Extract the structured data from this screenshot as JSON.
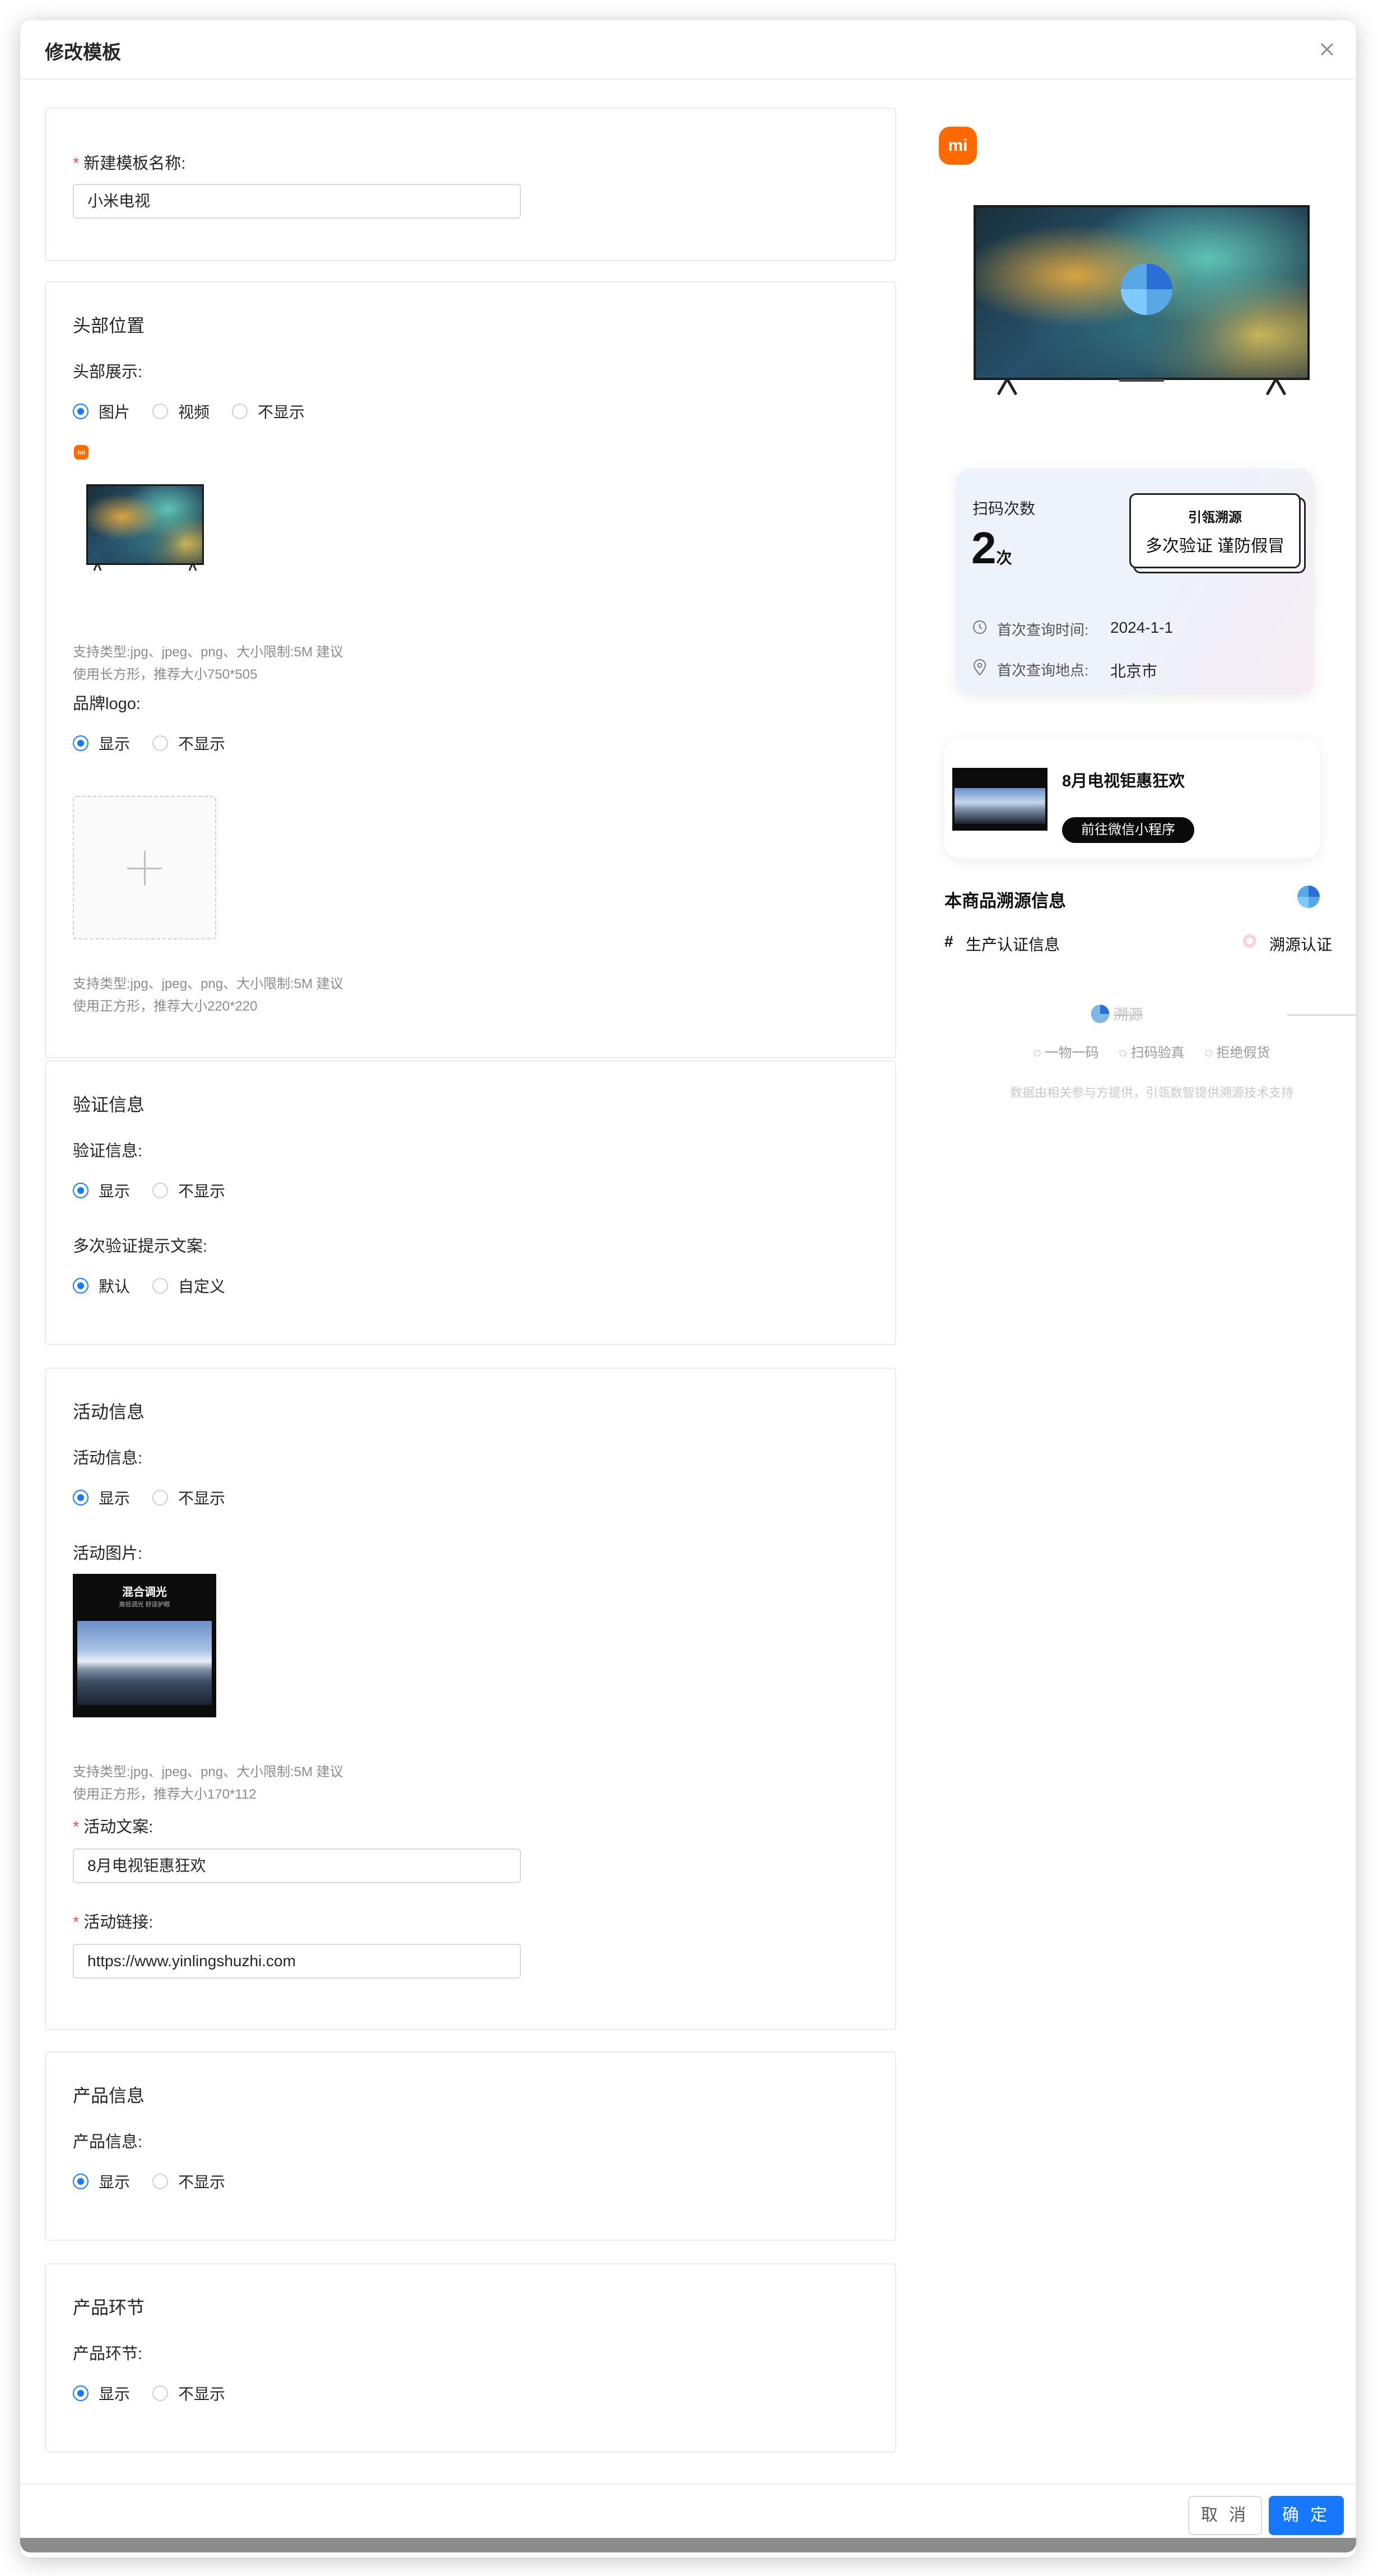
{
  "modal": {
    "title": "修改模板"
  },
  "template_name": {
    "label": "新建模板名称:",
    "value": "小米电视"
  },
  "header_section": {
    "title": "头部位置",
    "display_label": "头部展示:",
    "options": [
      "图片",
      "视频",
      "不显示"
    ],
    "selected": "图片",
    "hint_line1": "支持类型:jpg、jpeg、png、大小限制:5M 建议",
    "hint_line2": "使用长方形，推荐大小750*505",
    "brand_logo_label": "品牌logo:",
    "brand_options": [
      "显示",
      "不显示"
    ],
    "brand_selected": "显示",
    "logo_hint_line1": "支持类型:jpg、jpeg、png、大小限制:5M 建议",
    "logo_hint_line2": "使用正方形，推荐大小220*220"
  },
  "verify_section": {
    "title": "验证信息",
    "label": "验证信息:",
    "options": [
      "显示",
      "不显示"
    ],
    "selected": "显示",
    "tip_label": "多次验证提示文案:",
    "tip_options": [
      "默认",
      "自定义"
    ],
    "tip_selected": "默认"
  },
  "activity_section": {
    "title": "活动信息",
    "label": "活动信息:",
    "options": [
      "显示",
      "不显示"
    ],
    "selected": "显示",
    "image_label": "活动图片:",
    "poster_title": "混合调光",
    "poster_subtitle": "高低调光 舒适护眼",
    "hint_line1": "支持类型:jpg、jpeg、png、大小限制:5M 建议",
    "hint_line2": "使用正方形，推荐大小170*112",
    "copy_label": "活动文案:",
    "copy_value": "8月电视钜惠狂欢",
    "link_label": "活动链接:",
    "link_value": "https://www.yinlingshuzhi.com"
  },
  "product_section": {
    "title": "产品信息",
    "label": "产品信息:",
    "options": [
      "显示",
      "不显示"
    ],
    "selected": "显示"
  },
  "process_section": {
    "title": "产品环节",
    "label": "产品环节:",
    "options": [
      "显示",
      "不显示"
    ],
    "selected": "显示"
  },
  "preview": {
    "logo_text": "mi",
    "scan_count_label": "扫码次数",
    "scan_count": "2",
    "scan_count_unit": "次",
    "stamp_title": "引瓴溯源",
    "stamp_text": "多次验证 谨防假冒",
    "first_time_label": "首次查询时间:",
    "first_time_value": "2024-1-1",
    "first_place_label": "首次查询地点:",
    "first_place_value": "北京市",
    "activity_title": "8月电视钜惠狂欢",
    "activity_button": "前往微信小程序",
    "trace_title": "本商品溯源信息",
    "cert_label": "生产认证信息",
    "cert_hash": "#",
    "cert_badge": "溯源认证",
    "footer_brand": "溯源",
    "features": [
      "一物一码",
      "扫码验真",
      "拒绝假货"
    ],
    "footer_note": "数据由相关参与方提供，引瓴数智提供溯源技术支持"
  },
  "footer": {
    "cancel": "取 消",
    "ok": "确 定"
  },
  "colors": {
    "primary": "#1677ff",
    "required": "#ff4d4f",
    "brand": "#ff6a00"
  }
}
